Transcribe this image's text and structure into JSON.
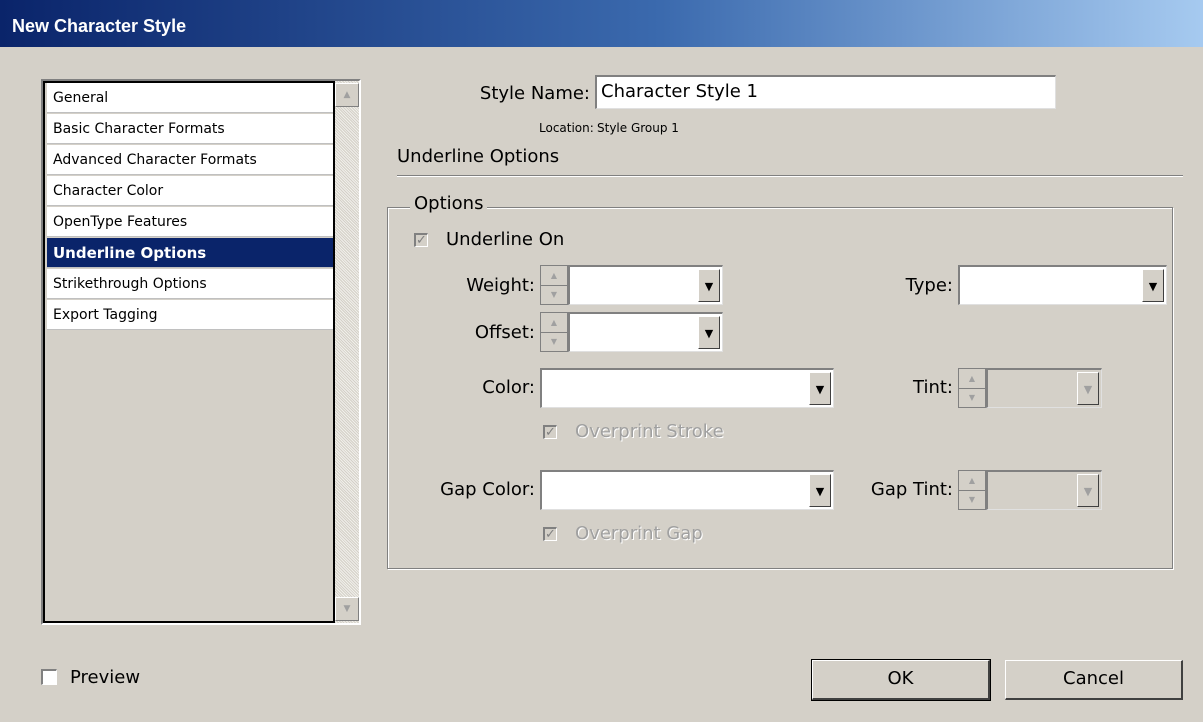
{
  "window": {
    "title": "New Character Style"
  },
  "sidebar": {
    "items": [
      {
        "label": "General"
      },
      {
        "label": "Basic Character Formats"
      },
      {
        "label": "Advanced Character Formats"
      },
      {
        "label": "Character Color"
      },
      {
        "label": "OpenType Features"
      },
      {
        "label": "Underline Options",
        "selected": true
      },
      {
        "label": "Strikethrough Options"
      },
      {
        "label": "Export Tagging"
      }
    ]
  },
  "header": {
    "style_name_label": "Style Name:",
    "style_name_value": "Character Style 1",
    "location_label": "Location:",
    "location_value": "Style Group 1",
    "section_title": "Underline Options"
  },
  "options": {
    "legend": "Options",
    "underline_on_label": "Underline On",
    "underline_on_checked": true,
    "weight_label": "Weight:",
    "weight_value": "",
    "type_label": "Type:",
    "type_value": "",
    "offset_label": "Offset:",
    "offset_value": "",
    "color_label": "Color:",
    "color_value": "",
    "tint_label": "Tint:",
    "tint_value": "",
    "overprint_stroke_label": "Overprint Stroke",
    "overprint_stroke_checked": true,
    "gap_color_label": "Gap Color:",
    "gap_color_value": "",
    "gap_tint_label": "Gap Tint:",
    "gap_tint_value": "",
    "overprint_gap_label": "Overprint Gap",
    "overprint_gap_checked": true
  },
  "footer": {
    "preview_label": "Preview",
    "preview_checked": false,
    "ok_label": "OK",
    "cancel_label": "Cancel"
  },
  "colors": {
    "dialog_bg": "#d4d0c8",
    "title_gradient_start": "#0a246a",
    "title_gradient_end": "#a6caf0",
    "selection": "#0a246a"
  }
}
